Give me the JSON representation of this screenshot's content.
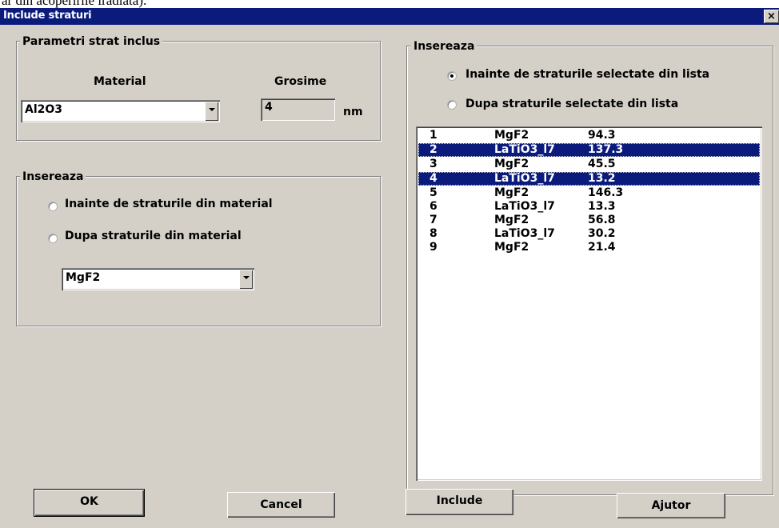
{
  "document_text": "ar din acoperirile iradiata).",
  "window": {
    "title": "Include straturi",
    "close_glyph": "×"
  },
  "params_group": {
    "legend": "Parametri strat inclus",
    "material_label": "Material",
    "material_value": "Al2O3",
    "thickness_label": "Grosime",
    "thickness_value": "4",
    "thickness_unit": "nm"
  },
  "insert_material_group": {
    "legend": "Insereaza",
    "options": [
      {
        "label": "Inainte de straturile din material",
        "checked": false
      },
      {
        "label": "Dupa straturile din material",
        "checked": false
      }
    ],
    "material_value": "MgF2"
  },
  "insert_list_group": {
    "legend": "Insereaza",
    "options": [
      {
        "label": "Inainte de straturile selectate din lista",
        "checked": true
      },
      {
        "label": "Dupa straturile selectate din lista",
        "checked": false
      }
    ]
  },
  "layers": [
    {
      "index": "1",
      "material": "MgF2",
      "thickness": "94.3",
      "selected": false
    },
    {
      "index": "2",
      "material": "LaTiO3_l7",
      "thickness": "137.3",
      "selected": true
    },
    {
      "index": "3",
      "material": "MgF2",
      "thickness": "45.5",
      "selected": false
    },
    {
      "index": "4",
      "material": "LaTiO3_l7",
      "thickness": "13.2",
      "selected": true
    },
    {
      "index": "5",
      "material": "MgF2",
      "thickness": "146.3",
      "selected": false
    },
    {
      "index": "6",
      "material": "LaTiO3_l7",
      "thickness": "13.3",
      "selected": false
    },
    {
      "index": "7",
      "material": "MgF2",
      "thickness": "56.8",
      "selected": false
    },
    {
      "index": "8",
      "material": "LaTiO3_l7",
      "thickness": "30.2",
      "selected": false
    },
    {
      "index": "9",
      "material": "MgF2",
      "thickness": "21.4",
      "selected": false
    }
  ],
  "buttons": {
    "ok": "OK",
    "cancel": "Cancel",
    "include": "Include",
    "help": "Ajutor"
  },
  "colors": {
    "titlebar": "#0a1b7c",
    "face": "#d4d0c8",
    "selection": "#0a1b7c"
  }
}
